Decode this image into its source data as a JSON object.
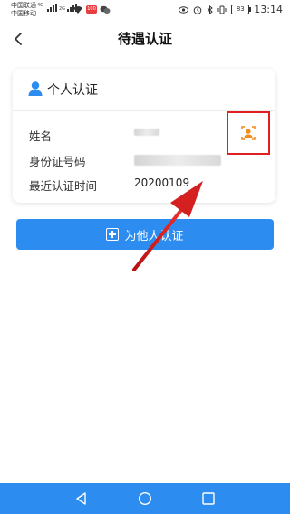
{
  "status_bar": {
    "carrier1": "中国联通",
    "carrier2": "中国移动",
    "net1": "4G",
    "net2": "2G",
    "badge": "100",
    "battery": "83",
    "time": "13:14"
  },
  "header": {
    "title": "待遇认证"
  },
  "card": {
    "title": "个人认证",
    "fields": [
      {
        "label": "姓名",
        "value": ""
      },
      {
        "label": "身份证号码",
        "value": ""
      },
      {
        "label": "最近认证时间",
        "value": "20200109"
      }
    ]
  },
  "button": {
    "label": "为他人认证"
  },
  "colors": {
    "accent": "#2d8cf0",
    "highlight": "#e02020",
    "face_icon": "#f08c1e"
  },
  "icons": [
    "back-arrow-icon",
    "person-icon",
    "face-recognition-icon",
    "plus-icon",
    "nav-back-icon",
    "nav-home-icon",
    "nav-recent-icon"
  ]
}
